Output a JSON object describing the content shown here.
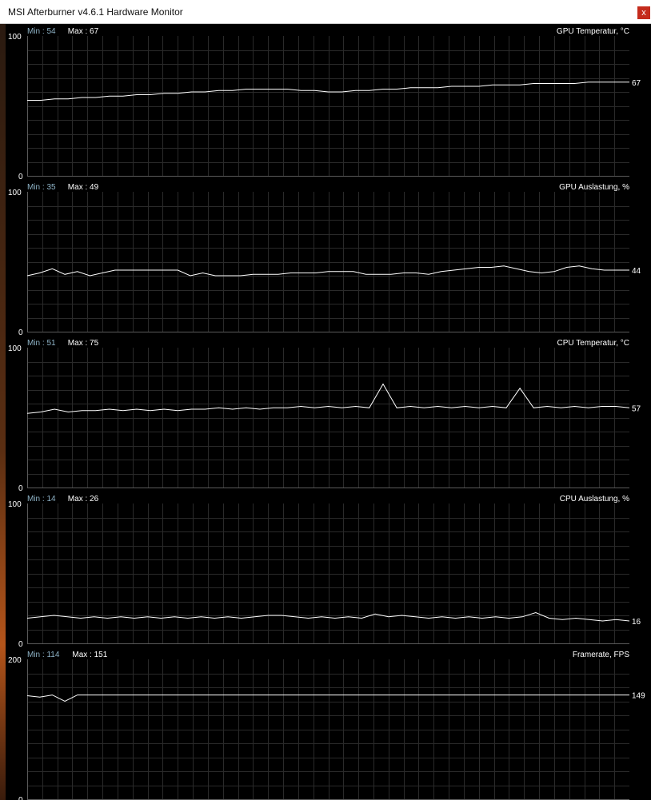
{
  "window": {
    "title": "MSI Afterburner v4.6.1 Hardware Monitor",
    "close_label": "x",
    "close_icon": "close-icon",
    "accent": "#c42b1c"
  },
  "graphs": [
    {
      "id": "gpu-temperature",
      "name": "GPU Temperatur, °C",
      "min_text": "Min : 54",
      "max_text": "Max : 67",
      "axis_max": "100",
      "axis_min": "0",
      "ymax": 100,
      "current": "67",
      "chart_data": {
        "type": "line",
        "series": [
          {
            "name": "GPU Temperatur, °C",
            "values": [
              54,
              54,
              55,
              55,
              56,
              56,
              57,
              57,
              58,
              58,
              59,
              59,
              60,
              60,
              61,
              61,
              62,
              62,
              62,
              62,
              61,
              61,
              60,
              60,
              61,
              61,
              62,
              62,
              63,
              63,
              63,
              64,
              64,
              64,
              65,
              65,
              65,
              66,
              66,
              66,
              66,
              67,
              67,
              67,
              67
            ]
          }
        ],
        "ylim": [
          0,
          100
        ],
        "line_color": "#ffffff"
      }
    },
    {
      "id": "gpu-usage",
      "name": "GPU Auslastung, %",
      "min_text": "Min : 35",
      "max_text": "Max : 49",
      "axis_max": "100",
      "axis_min": "0",
      "ymax": 100,
      "current": "44",
      "chart_data": {
        "type": "line",
        "series": [
          {
            "name": "GPU Auslastung, %",
            "values": [
              40,
              42,
              45,
              41,
              43,
              40,
              42,
              44,
              44,
              44,
              44,
              44,
              44,
              40,
              42,
              40,
              40,
              40,
              41,
              41,
              41,
              42,
              42,
              42,
              43,
              43,
              43,
              41,
              41,
              41,
              42,
              42,
              41,
              43,
              44,
              45,
              46,
              46,
              47,
              45,
              43,
              42,
              43,
              46,
              47,
              45,
              44,
              44,
              44
            ]
          }
        ],
        "ylim": [
          0,
          100
        ],
        "line_color": "#ffffff"
      }
    },
    {
      "id": "cpu-temperature",
      "name": "CPU Temperatur, °C",
      "min_text": "Min : 51",
      "max_text": "Max : 75",
      "axis_max": "100",
      "axis_min": "0",
      "ymax": 100,
      "current": "57",
      "chart_data": {
        "type": "line",
        "series": [
          {
            "name": "CPU Temperatur, °C",
            "values": [
              53,
              54,
              56,
              54,
              55,
              55,
              56,
              55,
              56,
              55,
              56,
              55,
              56,
              56,
              57,
              56,
              57,
              56,
              57,
              57,
              58,
              57,
              58,
              57,
              58,
              57,
              74,
              57,
              58,
              57,
              58,
              57,
              58,
              57,
              58,
              57,
              71,
              57,
              58,
              57,
              58,
              57,
              58,
              58,
              57
            ]
          }
        ],
        "ylim": [
          0,
          100
        ],
        "line_color": "#ffffff"
      }
    },
    {
      "id": "cpu-usage",
      "name": "CPU Auslastung, %",
      "min_text": "Min : 14",
      "max_text": "Max : 26",
      "axis_max": "100",
      "axis_min": "0",
      "ymax": 100,
      "current": "16",
      "chart_data": {
        "type": "line",
        "series": [
          {
            "name": "CPU Auslastung, %",
            "values": [
              18,
              19,
              20,
              19,
              18,
              19,
              18,
              19,
              18,
              19,
              18,
              19,
              18,
              19,
              18,
              19,
              18,
              19,
              20,
              20,
              19,
              18,
              19,
              18,
              19,
              18,
              21,
              19,
              20,
              19,
              18,
              19,
              18,
              19,
              18,
              19,
              18,
              19,
              22,
              18,
              17,
              18,
              17,
              16,
              17,
              16
            ]
          }
        ],
        "ylim": [
          0,
          100
        ],
        "line_color": "#ffffff"
      }
    },
    {
      "id": "framerate",
      "name": "Framerate, FPS",
      "min_text": "Min : 114",
      "max_text": "Max : 151",
      "axis_max": "200",
      "axis_min": "0",
      "ymax": 200,
      "current": "149",
      "chart_data": {
        "type": "line",
        "series": [
          {
            "name": "Framerate, FPS",
            "values": [
              148,
              146,
              149,
              140,
              149,
              149,
              149,
              149,
              149,
              149,
              149,
              149,
              149,
              149,
              149,
              149,
              149,
              149,
              149,
              149,
              149,
              149,
              149,
              149,
              149,
              149,
              149,
              149,
              149,
              149,
              149,
              149,
              149,
              149,
              149,
              149,
              149,
              149,
              149,
              149,
              149,
              149,
              149,
              149,
              149,
              149,
              149,
              149,
              149
            ]
          }
        ],
        "ylim": [
          0,
          200
        ],
        "line_color": "#ffffff"
      }
    }
  ]
}
